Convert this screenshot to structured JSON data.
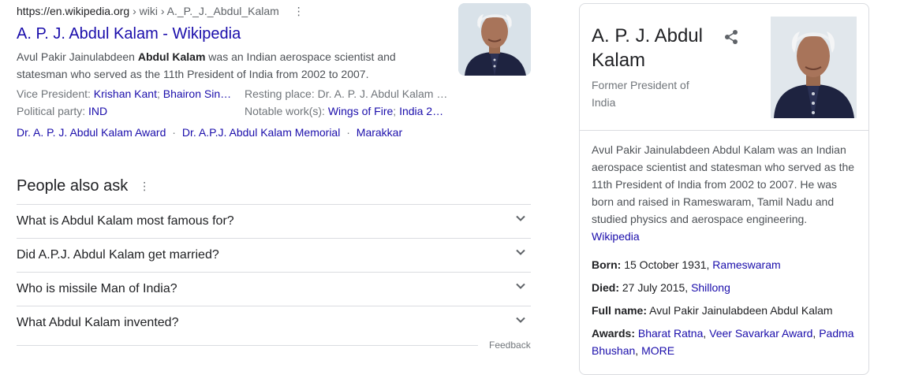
{
  "result": {
    "url": "https://en.wikipedia.org",
    "breadcrumb": " › wiki › A._P._J._Abdul_Kalam",
    "title": "A. P. J. Abdul Kalam - Wikipedia",
    "snippet_pre": "Avul Pakir Jainulabdeen ",
    "snippet_bold": "Abdul Kalam",
    "snippet_post": " was an Indian aerospace scientist and statesman who served as the 11th President of India from 2002 to 2007.",
    "attributes": {
      "vp_label": "Vice President: ",
      "vp_1": "Krishan Kant",
      "vp_sep": "; ",
      "vp_2": "Bhairon Sin…",
      "party_label": "Political party: ",
      "party_value": "IND",
      "resting_label": "Resting place: ",
      "resting_value": "Dr. A. P. J. Abdul Kalam …",
      "works_label": "Notable work(s): ",
      "works_1": "Wings of Fire",
      "works_sep": "; ",
      "works_2": "India 2…"
    },
    "sitelinks": [
      "Dr. A. P. J. Abdul Kalam Award",
      "Dr. A.P.J. Abdul Kalam Memorial",
      "Marakkar"
    ],
    "sitelink_sep": "·"
  },
  "paa": {
    "heading": "People also ask",
    "questions": [
      "What is Abdul Kalam most famous for?",
      "Did A.P.J. Abdul Kalam get married?",
      "Who is missile Man of India?",
      "What Abdul Kalam invented?"
    ],
    "feedback": "Feedback"
  },
  "knowledge_panel": {
    "title": "A. P. J. Abdul Kalam",
    "subtitle": "Former President of India",
    "description": "Avul Pakir Jainulabdeen Abdul Kalam was an Indian aerospace scientist and statesman who served as the 11th President of India from 2002 to 2007. He was born and raised in Rameswaram, Tamil Nadu and studied physics and aerospace engineering.",
    "source": "Wikipedia",
    "born_label": "Born:",
    "born_text": " 15 October 1931, ",
    "born_link": "Rameswaram",
    "died_label": "Died:",
    "died_text": " 27 July 2015, ",
    "died_link": "Shillong",
    "fullname_label": "Full name:",
    "fullname_text": " Avul Pakir Jainulabdeen Abdul Kalam",
    "awards_label": "Awards:",
    "awards_1": "Bharat Ratna",
    "awards_2": "Veer Savarkar Award",
    "awards_3": "Padma Bhushan",
    "awards_more": "MORE",
    "awards_sep": ", "
  },
  "colors": {
    "link": "#1a0dab",
    "text": "#202124",
    "muted": "#70757a",
    "border": "#dadce0"
  },
  "icons": [
    "more-vert-icon",
    "chevron-down-icon",
    "share-icon"
  ]
}
